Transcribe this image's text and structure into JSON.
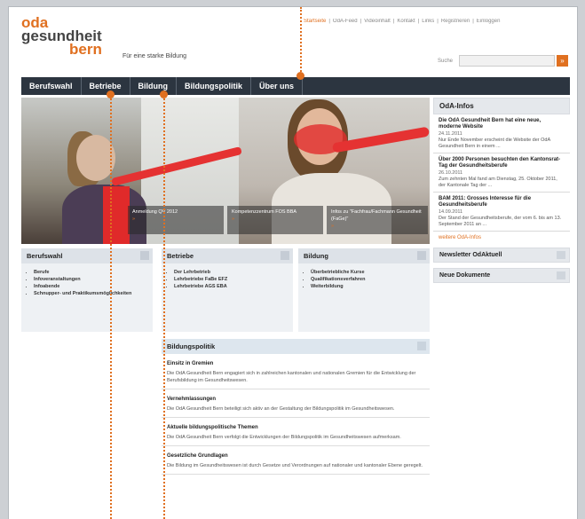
{
  "logo": {
    "line1": "oda",
    "line2": "gesundheit",
    "line3": "bern"
  },
  "tagline": "Für eine starke Bildung",
  "top_nav": {
    "items": [
      {
        "label": "Startseite",
        "active": true
      },
      {
        "label": "OdA-Feed",
        "active": false
      },
      {
        "label": "Videoinhalt",
        "active": false
      },
      {
        "label": "Kontakt",
        "active": false
      },
      {
        "label": "Links",
        "active": false
      },
      {
        "label": "Registrieren",
        "active": false
      },
      {
        "label": "Einloggen",
        "active": false
      }
    ],
    "separator": "|"
  },
  "search": {
    "label": "Suche",
    "placeholder": "",
    "button_icon": "»"
  },
  "main_nav": [
    "Berufswahl",
    "Betriebe",
    "Bildung",
    "Bildungspolitik",
    "Über uns"
  ],
  "hero": {
    "captions": [
      {
        "text": "Anmeldung QV 2012",
        "arrow": "»"
      },
      {
        "text": "Kompetenzzentrum FOS BBA",
        "arrow": "»"
      },
      {
        "text": "Infos zu \"Fachfrau/Fachmann Gesundheit (FaGe)\"",
        "arrow": "»"
      }
    ]
  },
  "sidebar": {
    "title": "OdA-Infos",
    "items": [
      {
        "title": "Die OdA Gesundheit Bern hat eine neue, moderne Website",
        "date": "24.11.2011",
        "text": "Nur Ende November erscheint die Website der OdA Gesundheit Bern in einem ..."
      },
      {
        "title": "Über 2000 Personen besuchten den Kantonsrat-Tag der Gesundheitsberufe",
        "date": "26.10.2011",
        "text": "Zum zehnten Mal fand am Dienstag, 25. Oktober 2011, der Kantonale Tag der ..."
      },
      {
        "title": "BAM 2011: Grosses Interesse für die Gesundheitsberufe",
        "date": "14.09.2011",
        "text": "Der Stand der Gesundheitsberufe, der vom 6. bis am 13. September 2011 an ..."
      }
    ],
    "more_link": "weitere OdA-Infos",
    "boxes": [
      "Newsletter OdAktuell",
      "Neue Dokumente"
    ]
  },
  "columns": [
    {
      "title": "Berufswahl",
      "items": [
        "Berufe",
        "Infoveranstaltungen",
        "Infoabende",
        "Schnupper- und Praktikumsmöglichkeiten"
      ]
    },
    {
      "title": "Betriebe",
      "items": [
        "Der Lehrbetrieb",
        "Lehrbetriebe FaBe EFZ",
        "Lehrbetriebe AGS EBA"
      ]
    },
    {
      "title": "Bildung",
      "items": [
        "Überbetriebliche Kurse",
        "Qualifikationsverfahren",
        "Weiterbildung"
      ]
    }
  ],
  "bildungspolitik": {
    "title": "Bildungspolitik",
    "items": [
      {
        "title": "Einsitz in Gremien",
        "text": "Die OdA Gesundheit Bern engagiert sich in zahlreichen kantonalen und nationalen Gremien für die Entwicklung der Berufsbildung im Gesundheitswesen."
      },
      {
        "title": "Vernehmlassungen",
        "text": "Die OdA Gesundheit Bern beteiligt sich aktiv an der Gestaltung der Bildungspolitik im Gesundheitswesen."
      },
      {
        "title": "Aktuelle bildungspolitische Themen",
        "text": "Die OdA Gesundheit Bern verfolgt die Entwicklungen der Bildungspolitik im Gesundheitswesen aufmerksam."
      },
      {
        "title": "Gesetzliche Grundlagen",
        "text": "Die Bildung im Gesundheitswesen ist durch Gesetze und Verordnungen auf nationaler und kantonaler Ebene geregelt."
      }
    ]
  },
  "colors": {
    "accent": "#e07020",
    "nav_bg": "#2c3540",
    "panel_bg": "#eef1f4"
  }
}
